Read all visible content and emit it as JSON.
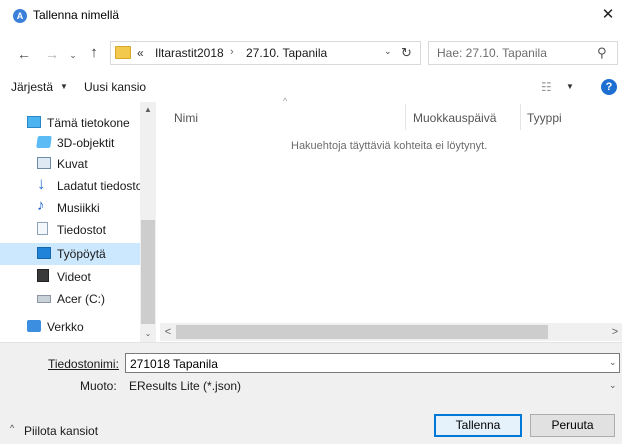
{
  "window": {
    "app_icon_glyph": "A",
    "title": "Tallenna nimellä",
    "close_glyph": "✕"
  },
  "nav_buttons": {
    "back": "←",
    "forward": "→",
    "recent": "⌄",
    "up": "↑"
  },
  "address": {
    "overflow": "«",
    "crumbs": [
      "Iltarastit2018",
      "27.10. Tapanila"
    ],
    "separator": "›",
    "dropdown_glyph": "⌄",
    "refresh_glyph": "↻"
  },
  "search": {
    "placeholder": "Hae: 27.10. Tapanila",
    "icon_glyph": "⚲"
  },
  "toolbar": {
    "organize_label": "Järjestä",
    "organize_caret": "▼",
    "new_folder_label": "Uusi kansio",
    "view_glyph": "☷",
    "view_caret": "▼",
    "help_glyph": "?"
  },
  "nav_pane": {
    "items": [
      {
        "label": "Tämä tietokone",
        "icon": "computer-icon"
      },
      {
        "label": "3D-objektit",
        "icon": "3d-objects-icon"
      },
      {
        "label": "Kuvat",
        "icon": "pictures-icon"
      },
      {
        "label": "Ladatut tiedosto",
        "icon": "downloads-icon"
      },
      {
        "label": "Musiikki",
        "icon": "music-icon"
      },
      {
        "label": "Tiedostot",
        "icon": "documents-icon"
      },
      {
        "label": "Työpöytä",
        "icon": "desktop-icon",
        "selected": true
      },
      {
        "label": "Videot",
        "icon": "videos-icon"
      },
      {
        "label": "Acer (C:)",
        "icon": "drive-icon"
      },
      {
        "label": "Verkko",
        "icon": "network-icon"
      }
    ],
    "scroll_up": "▲",
    "scroll_down": "⌄"
  },
  "content": {
    "columns": [
      "Nimi",
      "Muokkauspäivä",
      "Tyyppi"
    ],
    "sort_glyph": "^",
    "empty_message": "Hakuehtoja täyttäviä kohteita ei löytynyt.",
    "hscroll_left": "<",
    "hscroll_right": ">"
  },
  "form": {
    "filename_label": "Tiedostonimi:",
    "filename_value": "271018 Tapanila",
    "format_label": "Muoto:",
    "format_value": "EResults Lite (*.json)",
    "dropdown_glyph": "⌄"
  },
  "footer": {
    "hide_folders_label": "Piilota kansiot",
    "hide_folders_glyph": "^",
    "save_label": "Tallenna",
    "cancel_label": "Peruuta"
  },
  "colors": {
    "accent": "#0078d7",
    "selection": "#cce8ff",
    "panel": "#f0f0f0"
  }
}
